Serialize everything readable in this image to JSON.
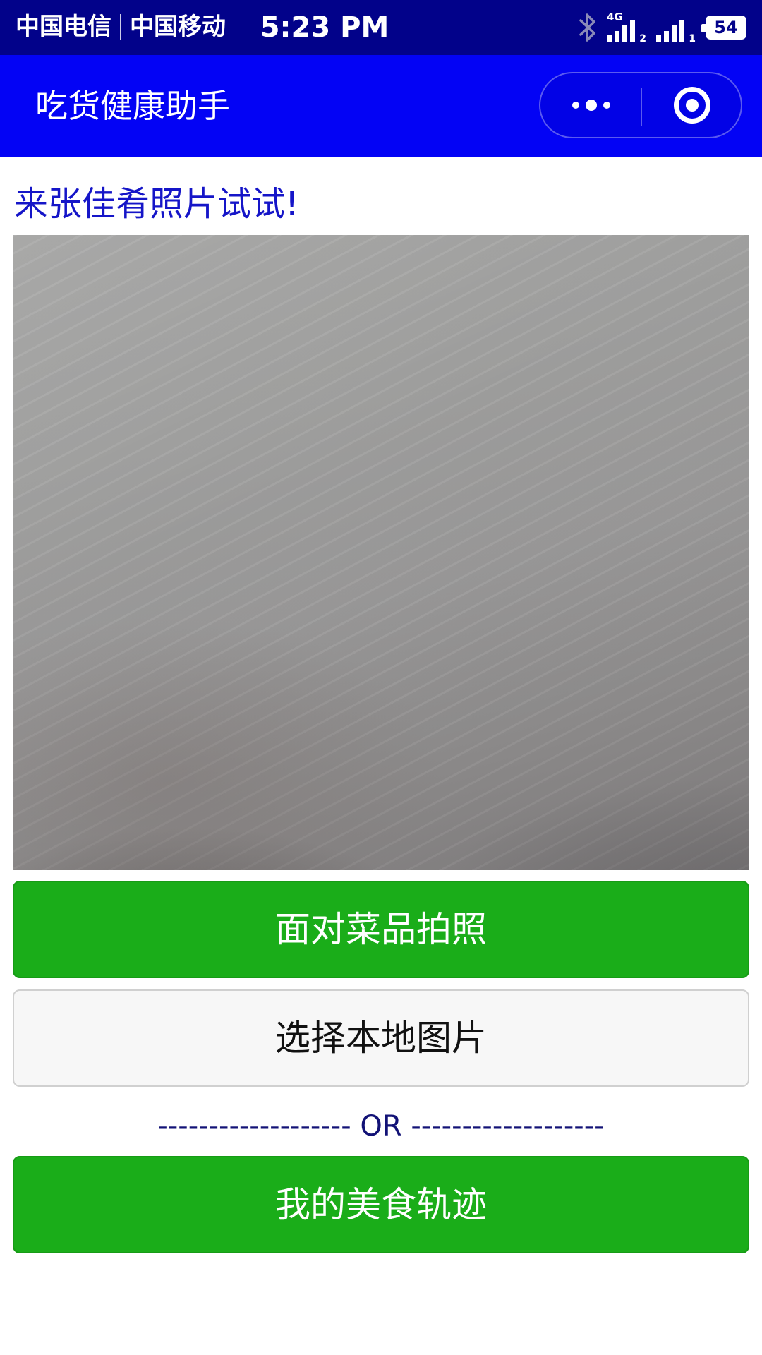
{
  "status_bar": {
    "carrier_1": "中国电信",
    "carrier_2": "中国移动",
    "time": "5:23 PM",
    "network_type": "4G",
    "sim_1": "2",
    "sim_2": "1",
    "battery_level": "54",
    "icons": [
      "bluetooth-icon",
      "signal-icon",
      "signal-icon",
      "battery-icon"
    ]
  },
  "nav_bar": {
    "title": "吃货健康助手",
    "background_color": "#0303f5",
    "capsule": {
      "more_icon": "more-dots-icon",
      "close_icon": "target-circle-icon"
    }
  },
  "main": {
    "prompt": "来张佳肴照片试试!",
    "prompt_color": "#1515c8",
    "photo": "camera-preview",
    "take_photo_label": "面对菜品拍照",
    "choose_image_label": "选择本地图片",
    "or_divider": "------------------- OR -------------------",
    "history_label": "我的美食轨迹",
    "accent_color": "#1aad19"
  }
}
